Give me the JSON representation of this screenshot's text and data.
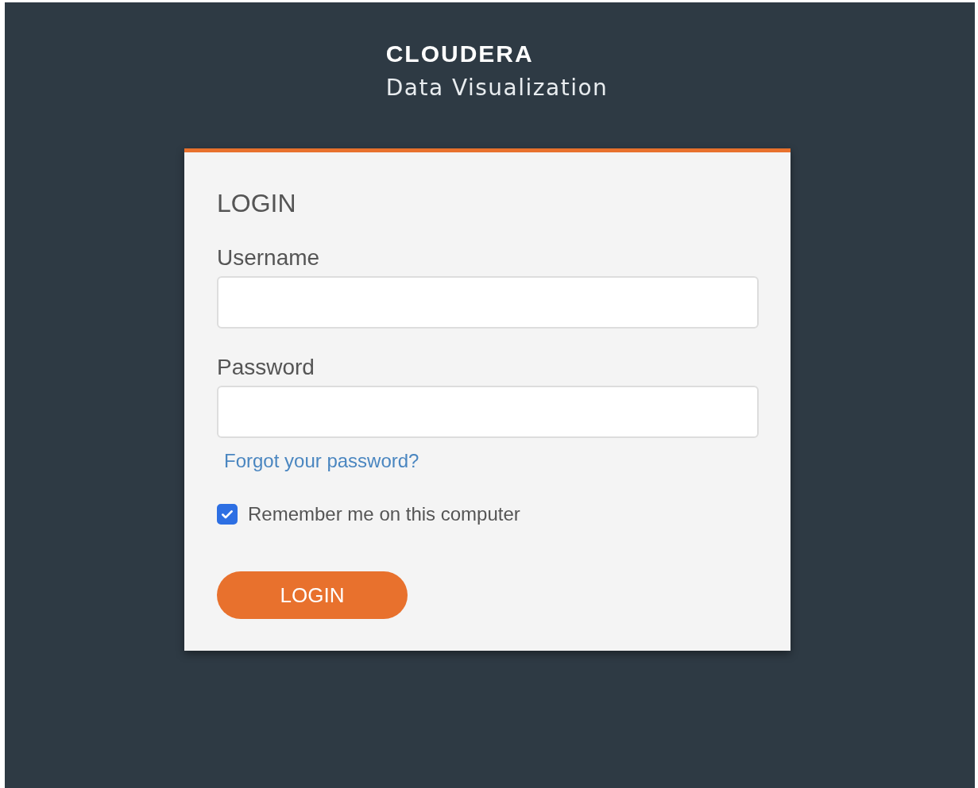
{
  "brand": {
    "name": "CLOUDERA",
    "product": "Data Visualization"
  },
  "form": {
    "title": "LOGIN",
    "fields": [
      {
        "label": "Username"
      },
      {
        "label": "Password"
      }
    ],
    "forgot_link": "Forgot your password?",
    "remember": {
      "label": "Remember me on this computer",
      "checked": true
    },
    "submit": "LOGIN"
  }
}
